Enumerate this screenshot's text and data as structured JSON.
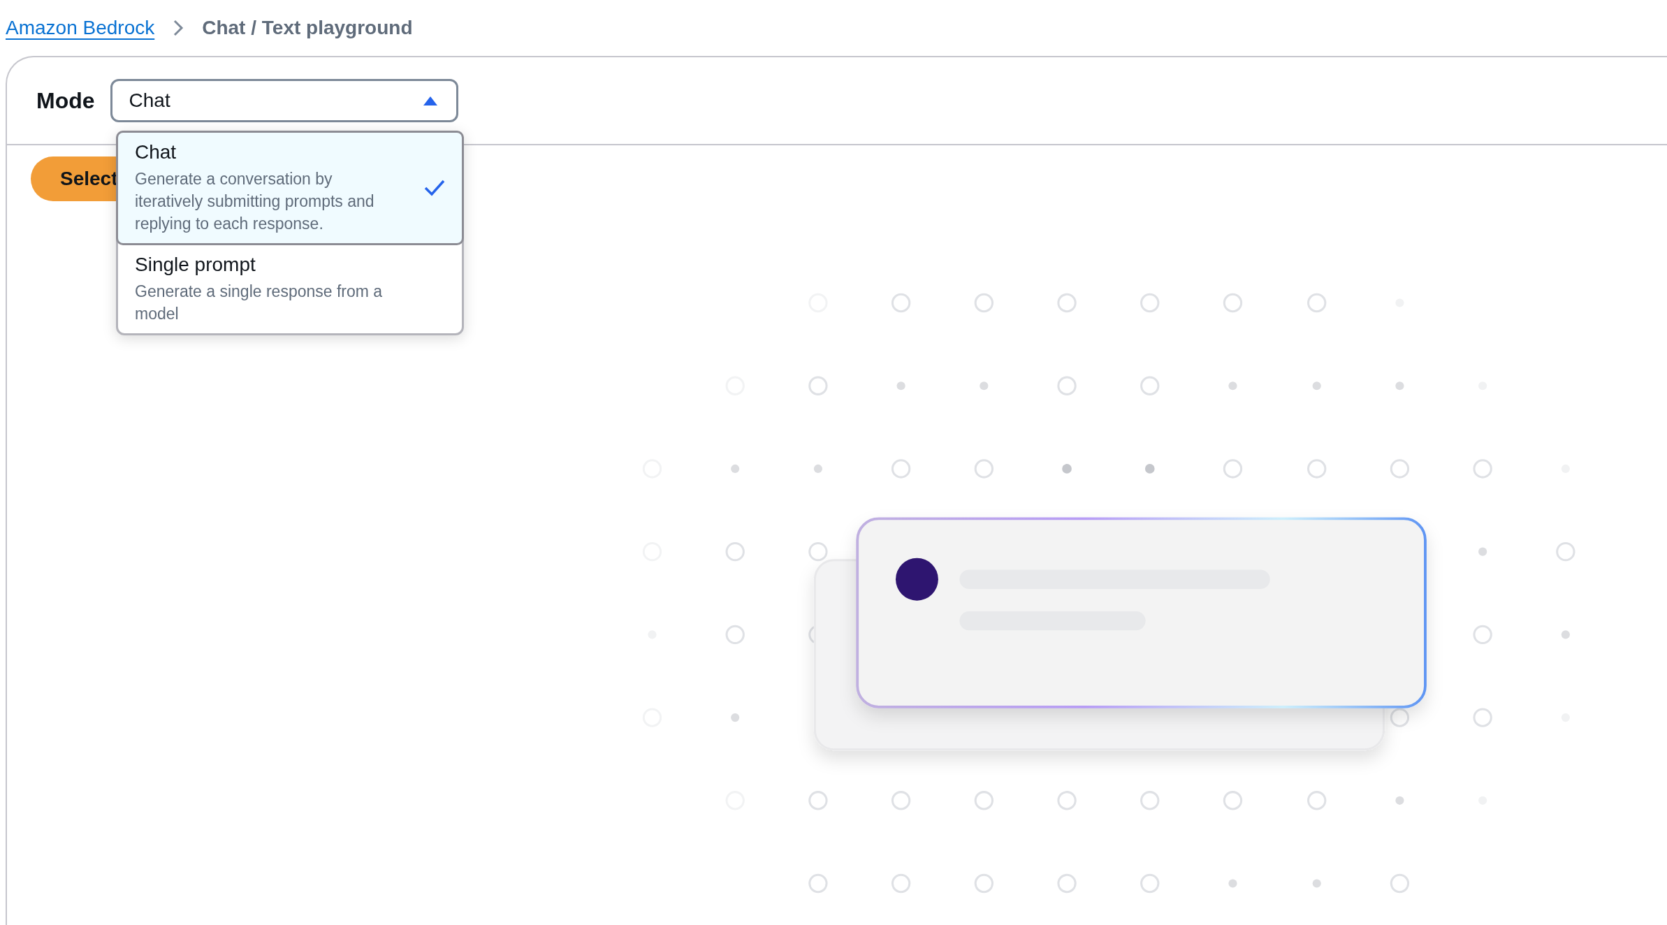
{
  "breadcrumbs": [
    {
      "label": "Amazon Bedrock",
      "kind": "link"
    },
    {
      "label": "Chat / Text playground",
      "kind": "current"
    }
  ],
  "mode": {
    "label": "Mode",
    "value": "Chat",
    "expanded": true,
    "options": [
      {
        "title": "Chat",
        "description": "Generate a conversation by iteratively submitting prompts and replying to each response.",
        "selected": true
      },
      {
        "title": "Single prompt",
        "description": "Generate a single response from a model",
        "selected": false
      }
    ]
  },
  "select_button": {
    "label": "Select"
  }
}
